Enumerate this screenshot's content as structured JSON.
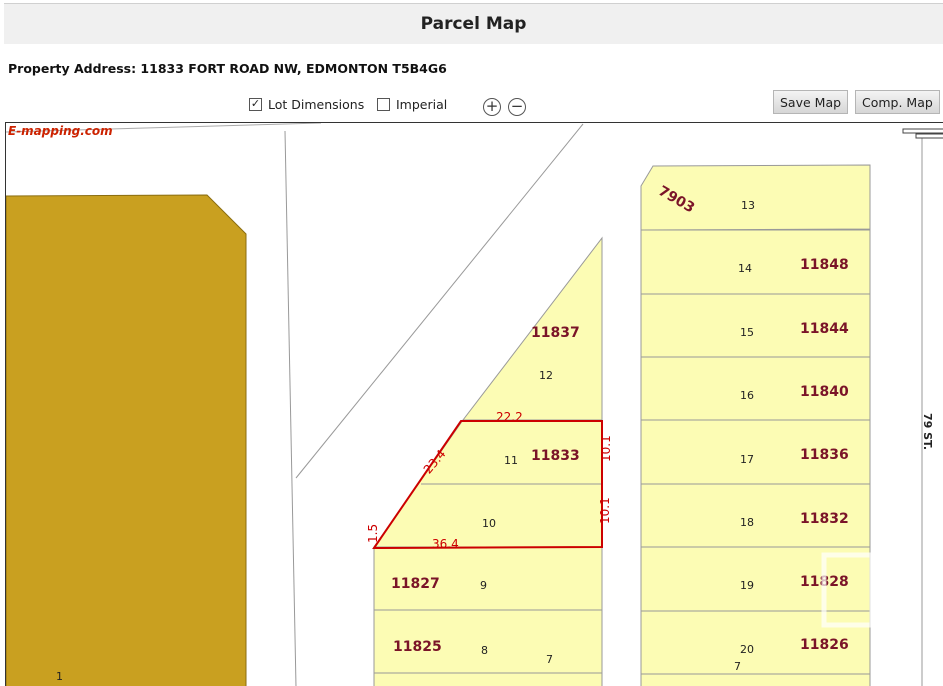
{
  "title": "Parcel Map",
  "address": "Property Address: 11833 FORT ROAD NW, EDMONTON T5B4G6",
  "toolbar": {
    "lot_dimensions_label": "Lot Dimensions",
    "lot_dimensions_checked": true,
    "imperial_label": "Imperial",
    "imperial_checked": false,
    "zoom_in_symbol": "+",
    "zoom_out_symbol": "−",
    "save_map_label": "Save Map",
    "comp_map_label": "Comp. Map"
  },
  "map": {
    "brand": "E-mapping.com",
    "street_label": "79 ST.",
    "house_numbers": {
      "h7903": "7903",
      "h11848": "11848",
      "h11844": "11844",
      "h11840": "11840",
      "h11836": "11836",
      "h11832": "11832",
      "h11828": "11828",
      "h11826": "11826",
      "h11837": "11837",
      "h11833": "11833",
      "h11827": "11827",
      "h11825": "11825"
    },
    "lot_numbers": {
      "l1": "1",
      "l7a": "7",
      "l7b": "7",
      "l8": "8",
      "l9": "9",
      "l10": "10",
      "l11": "11",
      "l12": "12",
      "l13": "13",
      "l14": "14",
      "l15": "15",
      "l16": "16",
      "l17": "17",
      "l18": "18",
      "l19": "19",
      "l20": "20"
    },
    "dimensions": {
      "top": "22.2",
      "diagonal": "23.4",
      "right_upper": "10.1",
      "right_lower": "10.1",
      "bottom": "36.4",
      "left": "1.5"
    },
    "colors": {
      "lot_fill": "#fcfcb4",
      "park_fill": "#c9a020",
      "subject_outline": "#cc0000",
      "house_number": "#7a1428",
      "dimension": "#cc0000"
    }
  }
}
